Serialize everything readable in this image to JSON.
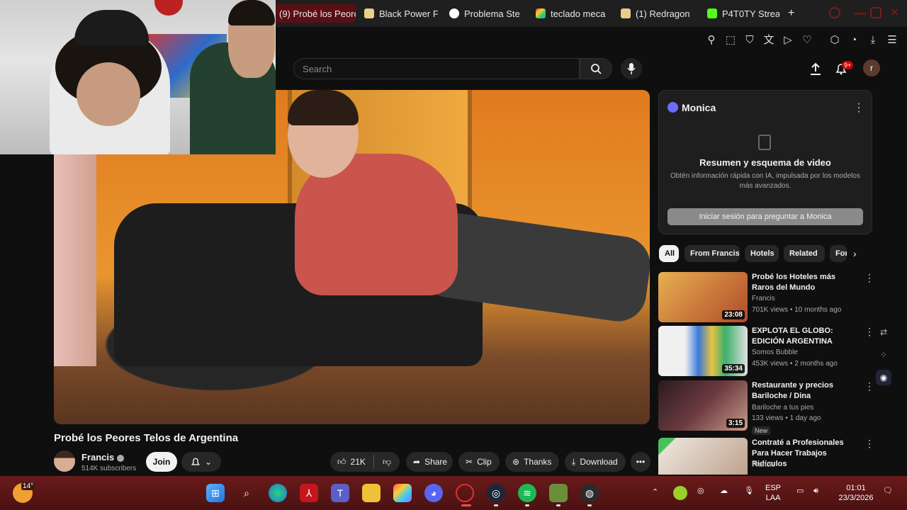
{
  "tabs": [
    {
      "label": "(9) Probé los Peore",
      "active": true,
      "icon": "youtube-icon"
    },
    {
      "label": "Black Power F",
      "icon": "duck-icon"
    },
    {
      "label": "Problema Ste",
      "icon": "chatgpt-icon"
    },
    {
      "label": "teclado meca",
      "icon": "bookmark-color-icon"
    },
    {
      "label": "(1) Redragon",
      "icon": "duck-icon"
    },
    {
      "label": "P4T0TY Strea",
      "icon": "kick-icon"
    }
  ],
  "new_tab_label": "+",
  "search": {
    "placeholder": "Search"
  },
  "notifications_badge": "9+",
  "account_initial": "r",
  "video": {
    "title": "Probé los Peores Telos de Argentina",
    "channel": "Francis",
    "subscribers": "514K subscribers",
    "join_label": "Join",
    "likes": "21K",
    "share_label": "Share",
    "clip_label": "Clip",
    "thanks_label": "Thanks",
    "download_label": "Download"
  },
  "monica": {
    "title": "Monica",
    "heading": "Resumen y esquema de video",
    "description": "Obtén información rápida con IA, impulsada por los modelos más avanzados.",
    "button": "Iniciar sesión para preguntar a Monica"
  },
  "chips": [
    "All",
    "From Francis",
    "Hotels",
    "Related",
    "For"
  ],
  "recommendations": [
    {
      "title": "Probé los Hoteles más Raros del Mundo",
      "channel": "Francis",
      "meta": "701K views • 10 months ago",
      "duration": "23:08",
      "thumb": "#c98a3a"
    },
    {
      "title": "EXPLOTA EL GLOBO: EDICIÓN ARGENTINA",
      "channel": "Somos Bubble",
      "meta": "453K views • 2 months ago",
      "duration": "35:34",
      "thumb": "#e7e7e7"
    },
    {
      "title": "Restaurante y precios Bariloche / Dina",
      "channel": "Bariloche a tus pies",
      "meta": "133 views • 1 day ago",
      "duration": "3:15",
      "new": "New",
      "thumb": "#4a2a30"
    },
    {
      "title": "Contraté a Profesionales Para Hacer Trabajos Ridículos",
      "channel": "Francis",
      "meta": "",
      "duration": "",
      "thumb": "#d8d0c8"
    }
  ],
  "taskbar": {
    "weather": "14°",
    "language": "ESP",
    "layout": "LAA",
    "time": "01:01",
    "date": "23/3/2026"
  }
}
